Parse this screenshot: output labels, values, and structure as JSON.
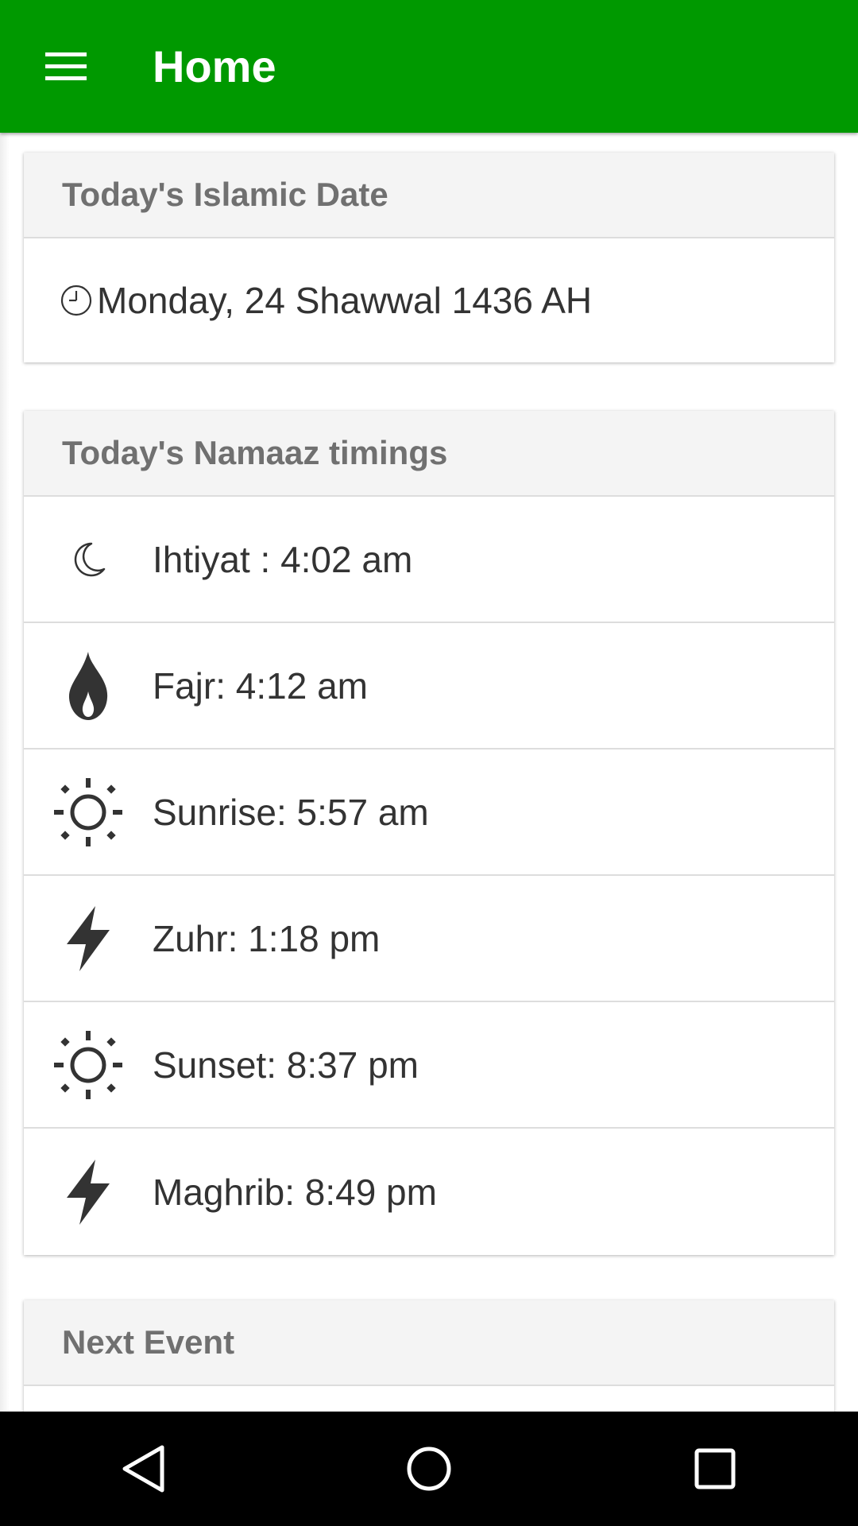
{
  "appbar": {
    "title": "Home",
    "background": "#009900"
  },
  "islamic_date_card": {
    "header": "Today's Islamic Date",
    "date": "Monday, 24 Shawwal 1436 AH",
    "icon": "clock-icon"
  },
  "namaaz_card": {
    "header": "Today's Namaaz timings",
    "items": [
      {
        "label": "Ihtiyat : 4:02 am",
        "icon": "moon-icon"
      },
      {
        "label": "Fajr: 4:12 am",
        "icon": "flame-icon"
      },
      {
        "label": "Sunrise: 5:57 am",
        "icon": "sun-icon"
      },
      {
        "label": "Zuhr: 1:18 pm",
        "icon": "lightning-icon"
      },
      {
        "label": "Sunset: 8:37 pm",
        "icon": "sun-icon"
      },
      {
        "label": "Maghrib: 8:49 pm",
        "icon": "lightning-icon"
      }
    ]
  },
  "next_event_card": {
    "header": "Next Event"
  },
  "navbar": {
    "buttons": [
      "back",
      "home",
      "recents"
    ]
  }
}
